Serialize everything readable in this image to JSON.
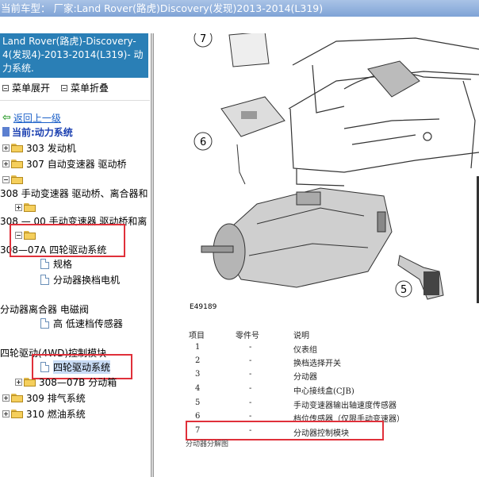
{
  "window": {
    "title": "当前车型： 厂家:Land Rover(路虎)Discovery(发现)2013-2014(L319)"
  },
  "sidebar": {
    "banner": "Land Rover(路虎)-Discovery-4(发现4)-2013-2014(L319)- 动力系统.",
    "expand_label": "菜单展开",
    "collapse_label": "菜单折叠",
    "back_label": "返回上一级",
    "current_label": "当前:动力系统",
    "tree": {
      "n303": "303 发动机",
      "n307": "307 自动变速器 驱动桥",
      "n308": "308 手动变速器 驱动桥、离合器和",
      "n308_00": "308 — 00 手动变速器 驱动桥和离",
      "n308_07a": "308—07A 四轮驱动系统",
      "spec": "规格",
      "shift_motor": "分动器换档电机",
      "solenoid": "分动器离合器 电磁阀",
      "sensor": "高 低速档传感器",
      "module": "四轮驱动(4WD)控制模块",
      "system_4wd": "四轮驱动系统",
      "n308_07b": "308—07B 分动箱",
      "n309": "309 排气系统",
      "n310": "310 燃油系统"
    }
  },
  "figure": {
    "id": "E49189",
    "callouts": [
      "7",
      "6",
      "5"
    ]
  },
  "table": {
    "headers": [
      "项目",
      "零件号",
      "说明"
    ],
    "rows": [
      {
        "item": "1",
        "part": "-",
        "desc": "仪表组"
      },
      {
        "item": "2",
        "part": "-",
        "desc": "换档选择开关"
      },
      {
        "item": "3",
        "part": "-",
        "desc": "分动器"
      },
      {
        "item": "4",
        "part": "-",
        "desc": "中心接线盒(CJB)"
      },
      {
        "item": "5",
        "part": "-",
        "desc": "手动变速器输出轴速度传感器"
      },
      {
        "item": "6",
        "part": "-",
        "desc": "档位传感器（仅限手动变速器）"
      },
      {
        "item": "7",
        "part": "-",
        "desc": "分动器控制模块"
      }
    ],
    "caption": "分动器分解图"
  },
  "colors": {
    "banner": "#2a7fb6",
    "highlight_box": "#e0303a",
    "link": "#1a5fc8"
  }
}
